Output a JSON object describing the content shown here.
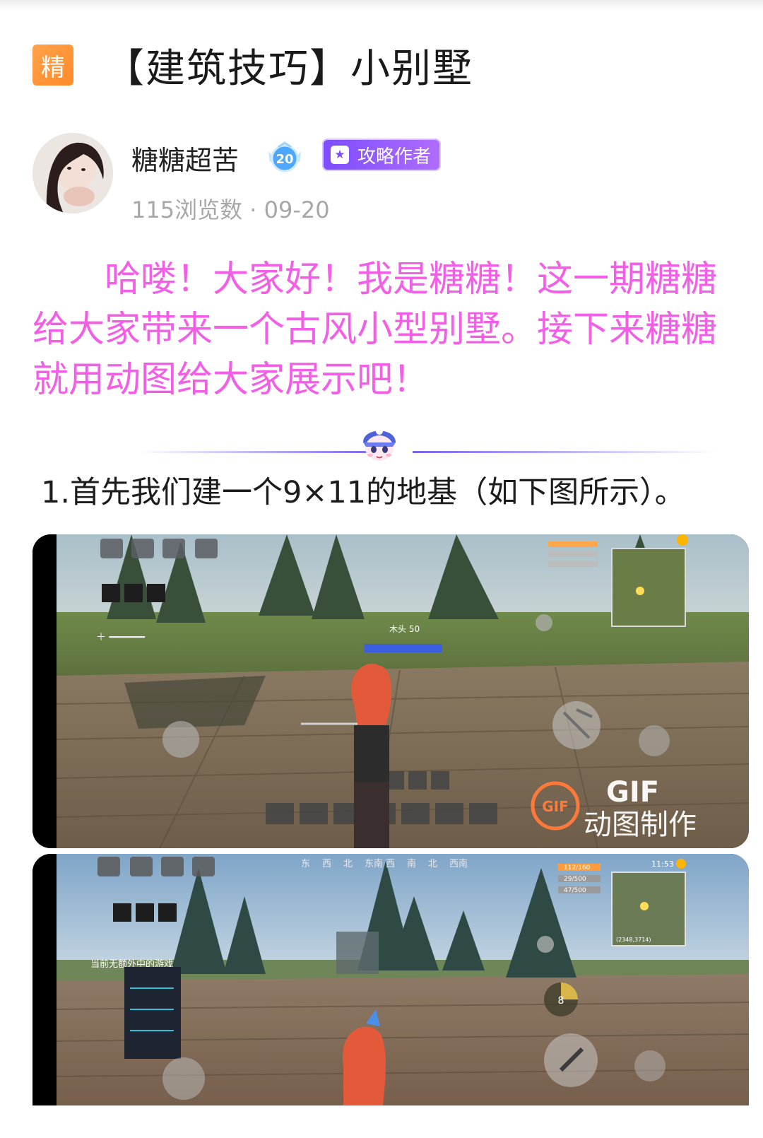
{
  "post": {
    "badge": "精",
    "title": "【建筑技巧】小别墅"
  },
  "author": {
    "name": "糖糖超苦",
    "level": "20",
    "tag": "攻略作者",
    "meta": "115浏览数 · 09-20"
  },
  "intro": "　　哈喽！大家好！我是糖糖！这一期糖糖给大家带来一个古风小型别墅。接下来糖糖就用动图给大家展示吧！",
  "step1": "1.首先我们建一个9×11的地基（如下图所示）。",
  "shot1": {
    "gif_badge": "GIF",
    "watermark_big": "GIF",
    "watermark_text": "动图制作",
    "hud_text": "木头 50"
  },
  "shot2": {
    "clock": "11:53",
    "stat1": "112/160",
    "stat2": "29/500",
    "stat3": "47/500",
    "coords": "(2348,3714)",
    "npc_label": "当前无额外中的游戏",
    "bullet_count": "8",
    "top_labels": [
      "东",
      "西",
      "北",
      "东南",
      "西",
      "南",
      "北",
      "西南"
    ]
  },
  "colors": {
    "intro_pink": "#f25fe6",
    "badge_orange": "#ff8a2a",
    "tag_purple": "#7c4dff"
  }
}
